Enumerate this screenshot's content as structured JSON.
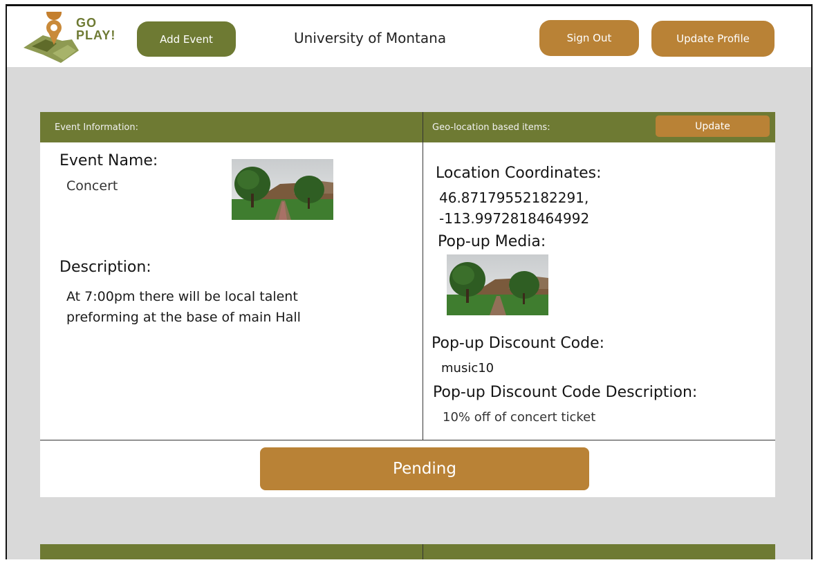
{
  "colors": {
    "olive": "#6e7a33",
    "tan": "#b98236",
    "background": "#d9d9d9"
  },
  "header": {
    "logo": {
      "line1": "GO",
      "line2": "PLAY!",
      "icon": "go-play-logo-map-pin"
    },
    "add_event_label": "Add Event",
    "university": "University of Montana",
    "sign_out_label": "Sign Out",
    "update_profile_label": "Update Profile"
  },
  "event_panel": {
    "left_header": "Event Information:",
    "right_header": "Geo-location based items:",
    "update_label": "Update",
    "event_name_label": "Event Name:",
    "event_name": "Concert",
    "event_photo": "campus-oval-photo",
    "description_label": "Description:",
    "description": "At 7:00pm there will be local talent preforming at the base of main Hall",
    "coordinates_label": "Location Coordinates:",
    "latitude": "46.87179552182291,",
    "longitude": "-113.9972818464992",
    "media_label": "Pop-up Media:",
    "media_photo": "campus-oval-photo",
    "discount_label": "Pop-up Discount Code:",
    "discount_code": "music10",
    "discount_desc_label": "Pop-up Discount Code Description:",
    "discount_desc": "10% off of concert ticket",
    "status_label": "Pending"
  }
}
